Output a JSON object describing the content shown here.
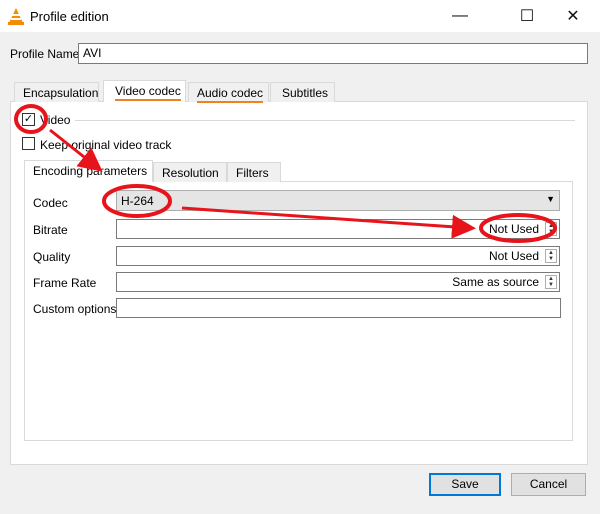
{
  "window": {
    "title": "Profile edition",
    "minimize": "—",
    "maximize": "☐",
    "close": "✕"
  },
  "profile": {
    "label": "Profile Name",
    "value": "AVI"
  },
  "tabs": [
    {
      "label": "Encapsulation"
    },
    {
      "label": "Video codec",
      "selected": true
    },
    {
      "label": "Audio codec"
    },
    {
      "label": "Subtitles"
    }
  ],
  "video": {
    "checkbox_label": "Video",
    "checked": true,
    "keep_label": "Keep original video track",
    "keep_checked": false
  },
  "subtabs": [
    {
      "label": "Encoding parameters",
      "selected": true
    },
    {
      "label": "Resolution"
    },
    {
      "label": "Filters"
    }
  ],
  "fields": {
    "codec": {
      "label": "Codec",
      "value": "H-264"
    },
    "bitrate": {
      "label": "Bitrate",
      "value": "Not Used"
    },
    "quality": {
      "label": "Quality",
      "value": "Not Used"
    },
    "framerate": {
      "label": "Frame Rate",
      "value": "Same as source"
    },
    "custom": {
      "label": "Custom options",
      "value": ""
    }
  },
  "buttons": {
    "save": "Save",
    "cancel": "Cancel"
  },
  "colors": {
    "annotation": "#e8141b",
    "tab_underline": "#f08020",
    "accent": "#0078d7"
  }
}
